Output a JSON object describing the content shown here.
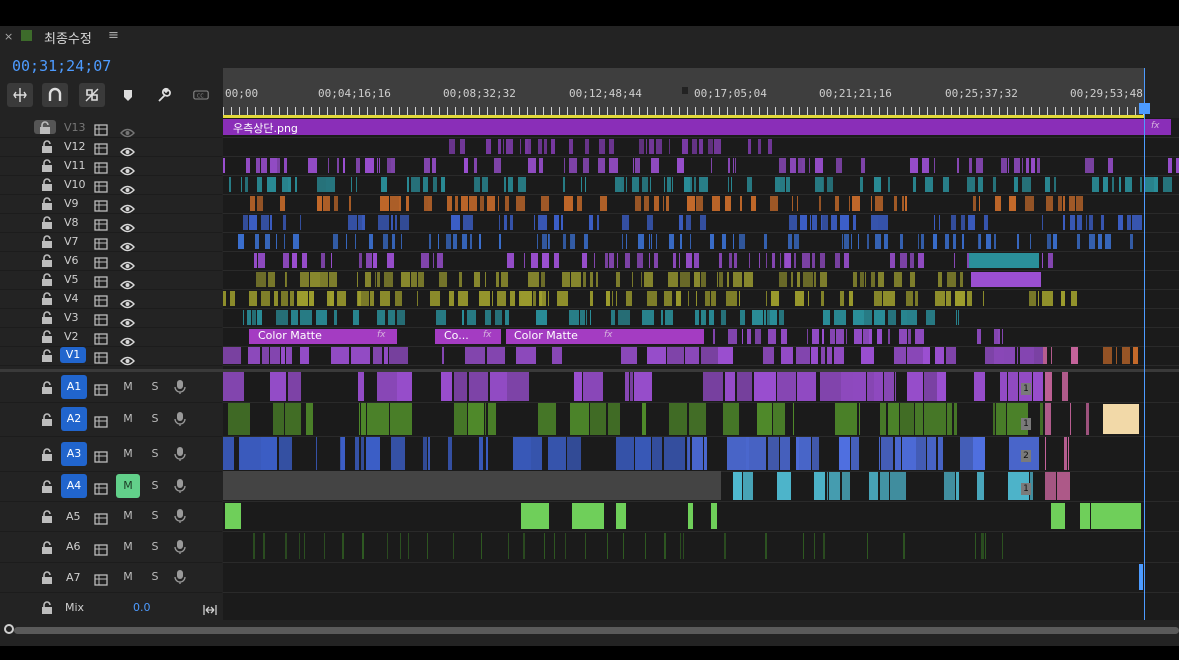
{
  "panel": {
    "close_glyph": "×",
    "title": "최종수정",
    "menu_glyph": "≡",
    "timecode": "00;31;24;07",
    "accent": "#4d9bff"
  },
  "ruler": {
    "labels": [
      "00;00",
      "00;04;16;16",
      "00;08;32;32",
      "00;12;48;44",
      "00;17;05;04",
      "00;21;21;16",
      "00;25;37;32",
      "00;29;53;48"
    ]
  },
  "tools": [
    "insert-nest-icon",
    "snap-magnet-icon",
    "linked-selection-icon",
    "add-marker-icon",
    "wrench-settings-icon",
    "captions-icon"
  ],
  "video_tracks": [
    {
      "name": "V13",
      "locked": true
    },
    {
      "name": "V12"
    },
    {
      "name": "V11"
    },
    {
      "name": "V10"
    },
    {
      "name": "V9"
    },
    {
      "name": "V8"
    },
    {
      "name": "V7"
    },
    {
      "name": "V6"
    },
    {
      "name": "V5"
    },
    {
      "name": "V4"
    },
    {
      "name": "V3"
    },
    {
      "name": "V2"
    },
    {
      "name": "V1",
      "selected": true
    }
  ],
  "audio_tracks": [
    {
      "name": "A1",
      "selected": true,
      "m": "M",
      "s": "S"
    },
    {
      "name": "A2",
      "selected": true,
      "m": "M",
      "s": "S"
    },
    {
      "name": "A3",
      "selected": true,
      "m": "M",
      "s": "S"
    },
    {
      "name": "A4",
      "selected": true,
      "m": "M",
      "s": "S",
      "muted": true
    },
    {
      "name": "A5",
      "m": "M",
      "s": "S"
    },
    {
      "name": "A6",
      "m": "M",
      "s": "S"
    },
    {
      "name": "A7",
      "m": "M",
      "s": "S"
    }
  ],
  "mix": {
    "label": "Mix",
    "value": "0.0"
  },
  "clips": {
    "v13_label": "우측상단.png",
    "fx": "fx",
    "color_matte_1": "Color Matte",
    "color_matte_2": "Co...",
    "color_matte_3": "Color Matte",
    "badges": [
      "1",
      "1",
      "2",
      "1"
    ]
  },
  "colors": {
    "purple": "#8a2eb8",
    "violet": "#9b4fd1",
    "green": "#4f8a2a",
    "blue": "#3c5fc8",
    "teal": "#2a8f9a",
    "olive": "#8a8a2e",
    "orange": "#c56a2a",
    "pink": "#d46aa6",
    "cyan": "#4fb9d0",
    "lightgreen": "#6fcf5a"
  }
}
